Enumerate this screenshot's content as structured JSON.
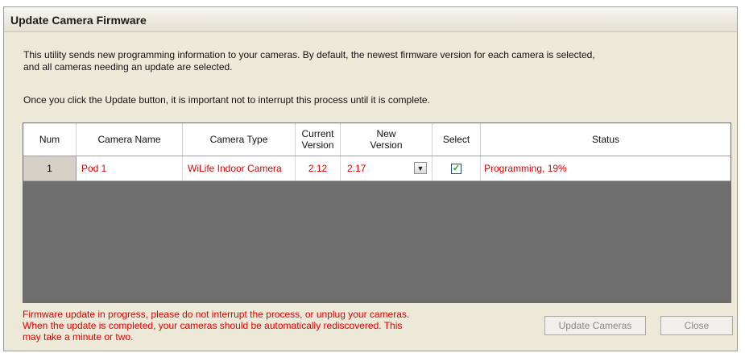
{
  "window": {
    "title": "Update Camera Firmware"
  },
  "intro": {
    "line1": "This utility sends new programming information to your cameras.  By default, the newest firmware version for each camera is selected,",
    "line2": "and all cameras needing an update are selected.",
    "line3": "Once you click the Update button, it is important not to interrupt this process until it is complete."
  },
  "table": {
    "headers": {
      "num": "Num",
      "camera_name": "Camera Name",
      "camera_type": "Camera Type",
      "current_version_1": "Current",
      "current_version_2": "Version",
      "new_version_1": "New",
      "new_version_2": "Version",
      "select": "Select",
      "status": "Status"
    },
    "rows": [
      {
        "num": "1",
        "camera_name": "Pod 1",
        "camera_type": "WiLife Indoor Camera",
        "current_version": "2.12",
        "new_version": "2.17",
        "selected": true,
        "status": "Programming, 19%"
      }
    ]
  },
  "warning": {
    "line1": "Firmware update in progress, please do not interrupt the process, or unplug your cameras.",
    "line2": "When the update is completed, your cameras should be automatically rediscovered.  This",
    "line3": "may take a minute or two."
  },
  "buttons": {
    "update": "Update Cameras",
    "close": "Close"
  },
  "icons": {
    "dropdown": "chevron-down-icon",
    "checkbox": "checkmark-icon"
  },
  "colors": {
    "status_text": "#e00000",
    "grid_empty": "#6e6e6e"
  }
}
